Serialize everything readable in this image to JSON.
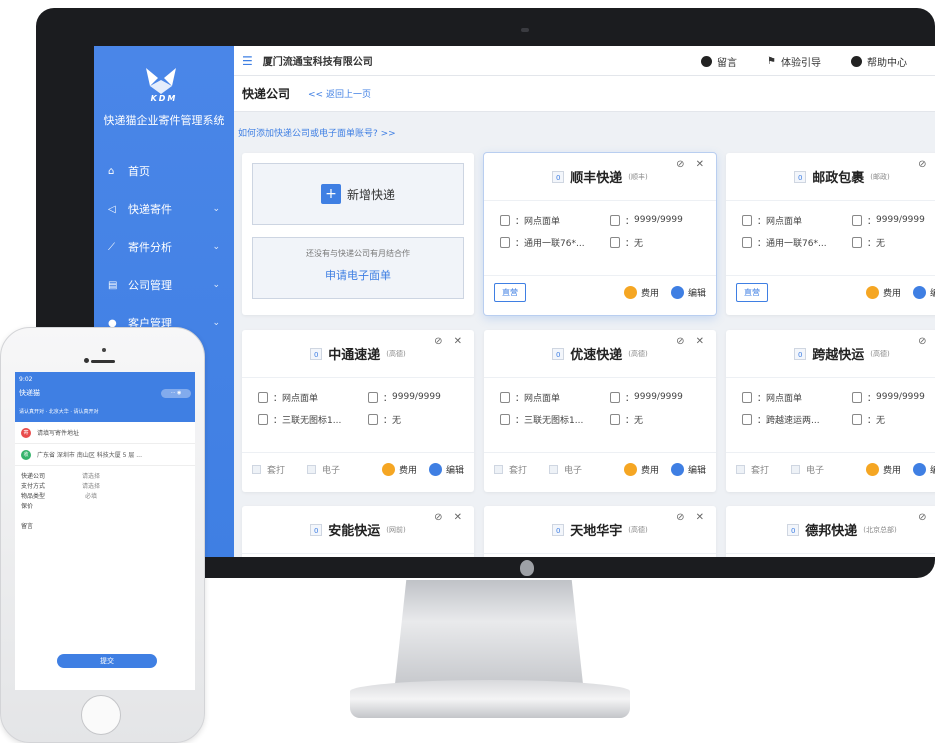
{
  "sidebar": {
    "logo_text": "KDM",
    "system_title": "快递猫企业寄件管理系统",
    "items": [
      {
        "label": "首页",
        "icon": "home-icon"
      },
      {
        "label": "快递寄件",
        "icon": "send-icon"
      },
      {
        "label": "寄件分析",
        "icon": "chart-icon"
      },
      {
        "label": "公司管理",
        "icon": "building-icon"
      },
      {
        "label": "客户管理",
        "icon": "user-icon"
      }
    ]
  },
  "topbar": {
    "company": "厦门流通宝科技有限公司",
    "message": "留言",
    "guide": "体验引导",
    "help": "帮助中心"
  },
  "page": {
    "title": "快递公司",
    "back": "<< 返回上一页",
    "help_link": "如何添加快递公司或电子面单账号? >>"
  },
  "add_card": {
    "add_label": "新增快递",
    "hint": "还没有与快递公司有月结合作",
    "apply_link": "申请电子面单"
  },
  "carriers": [
    {
      "count": "0",
      "name": "顺丰快递",
      "sub": "(顺丰)",
      "left1": "网点面单",
      "right1": "9999/9999",
      "left2": "通用一联76*...",
      "right2": "无",
      "foot": "zg",
      "zg": "直营",
      "fee": "费用",
      "edit": "编辑"
    },
    {
      "count": "0",
      "name": "邮政包裹",
      "sub": "(邮政)",
      "left1": "网点面单",
      "right1": "9999/9999",
      "left2": "通用一联76*...",
      "right2": "无",
      "foot": "zg",
      "zg": "直营",
      "fee": "费用",
      "edit": "编辑"
    },
    {
      "count": "0",
      "name": "中通速递",
      "sub": "(高德)",
      "left1": "网点面单",
      "right1": "9999/9999",
      "left2": "三联无图标1...",
      "right2": "无",
      "foot": "chk",
      "chk1": "套打",
      "chk2": "电子",
      "fee": "费用",
      "edit": "编辑"
    },
    {
      "count": "0",
      "name": "优速快递",
      "sub": "(高德)",
      "left1": "网点面单",
      "right1": "9999/9999",
      "left2": "三联无图标1...",
      "right2": "无",
      "foot": "chk",
      "chk1": "套打",
      "chk2": "电子",
      "fee": "费用",
      "edit": "编辑"
    },
    {
      "count": "0",
      "name": "跨越快运",
      "sub": "(高德)",
      "left1": "网点面单",
      "right1": "9999/9999",
      "left2": "跨越速运两...",
      "right2": "无",
      "foot": "chk",
      "chk1": "套打",
      "chk2": "电子",
      "fee": "费用",
      "edit": "编辑"
    },
    {
      "count": "0",
      "name": "安能快运",
      "sub": "(网前)",
      "foot": "none"
    },
    {
      "count": "0",
      "name": "天地华宇",
      "sub": "(高德)",
      "foot": "none"
    },
    {
      "count": "0",
      "name": "德邦快递",
      "sub": "(北京总部)",
      "foot": "none"
    }
  ],
  "phone": {
    "time": "9:02",
    "app_title": "快递猫",
    "notice": "请认真开对 · 北京大华 · 请认真开对",
    "sender": "请填写寄件地址",
    "receiver": "广东省 深圳市 南山区 科技大厦 5 层 ...",
    "form": [
      {
        "label": "快递公司",
        "value": "请选择"
      },
      {
        "label": "支付方式",
        "value": "请选择"
      },
      {
        "label": "物品类型",
        "value": "必填"
      }
    ],
    "weight_label": "保价",
    "remark": "留言",
    "submit": "提交"
  }
}
